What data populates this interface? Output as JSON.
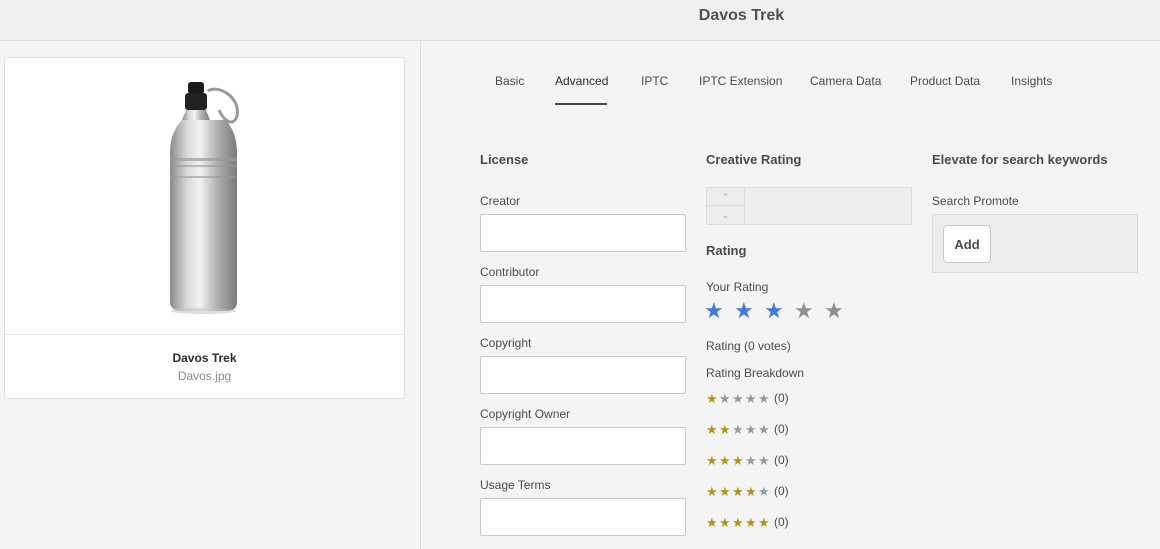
{
  "header": {
    "title": "Davos Trek"
  },
  "asset": {
    "name": "Davos Trek",
    "filename": "Davos.jpg",
    "thumbnail_icon": "water-bottle-thumbnail"
  },
  "tabs": [
    {
      "label": "Basic",
      "active": false
    },
    {
      "label": "Advanced",
      "active": true
    },
    {
      "label": "IPTC",
      "active": false
    },
    {
      "label": "IPTC Extension",
      "active": false
    },
    {
      "label": "Camera Data",
      "active": false
    },
    {
      "label": "Product Data",
      "active": false
    },
    {
      "label": "Insights",
      "active": false
    }
  ],
  "license": {
    "heading": "License",
    "fields": [
      {
        "label": "Creator",
        "value": ""
      },
      {
        "label": "Contributor",
        "value": ""
      },
      {
        "label": "Copyright",
        "value": ""
      },
      {
        "label": "Copyright Owner",
        "value": ""
      },
      {
        "label": "Usage Terms",
        "value": ""
      }
    ]
  },
  "creative_rating": {
    "heading": "Creative Rating",
    "value": ""
  },
  "rating": {
    "heading": "Rating",
    "your_rating_label": "Your Rating",
    "your_rating": 3,
    "max": 5,
    "votes_text": "Rating (0 votes)",
    "breakdown_label": "Rating Breakdown",
    "breakdown": [
      {
        "stars": 1,
        "count_text": "(0)"
      },
      {
        "stars": 2,
        "count_text": "(0)"
      },
      {
        "stars": 3,
        "count_text": "(0)"
      },
      {
        "stars": 4,
        "count_text": "(0)"
      },
      {
        "stars": 5,
        "count_text": "(0)"
      }
    ]
  },
  "elevate": {
    "heading": "Elevate for search keywords",
    "search_promote_label": "Search Promote",
    "add_label": "Add"
  },
  "colors": {
    "rating_star_on": "#3d7ed6",
    "breakdown_star_on": "#b5911c",
    "star_off": "#8f8f8f"
  }
}
